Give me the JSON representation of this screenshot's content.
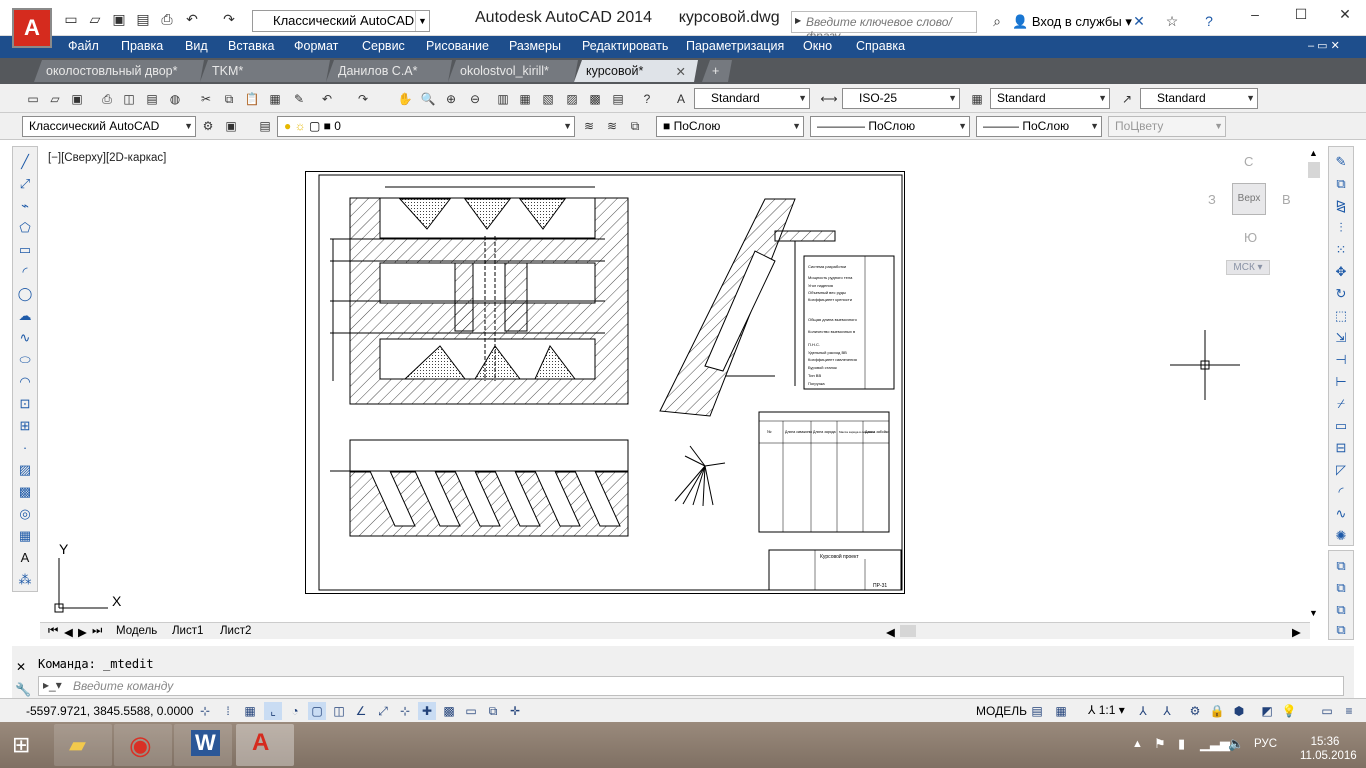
{
  "title_bar": {
    "app_name": "Autodesk AutoCAD 2014",
    "file_name": "курсовой.dwg",
    "workspace": "Классический AutoCAD",
    "search_placeholder": "Введите ключевое слово/фразу",
    "signin": "Вход в службы"
  },
  "menu": [
    "Файл",
    "Правка",
    "Вид",
    "Вставка",
    "Формат",
    "Сервис",
    "Рисование",
    "Размеры",
    "Редактировать",
    "Параметризация",
    "Окно",
    "Справка"
  ],
  "file_tabs": [
    {
      "label": "околостовльный двор*",
      "active": false
    },
    {
      "label": "TKM*",
      "active": false
    },
    {
      "label": "Данилов С.А*",
      "active": false
    },
    {
      "label": "okolostvol_kirill*",
      "active": false
    },
    {
      "label": "курсовой*",
      "active": true
    }
  ],
  "styles_toolbar": {
    "text_style": "Standard",
    "dim_style": "ISO-25",
    "table_style": "Standard",
    "mleader_style": "Standard"
  },
  "layers_toolbar": {
    "workspace": "Классический AutoCAD",
    "layer": "0",
    "color": "ПоСлою",
    "linetype": "ПоСлою",
    "lineweight": "ПоСлою",
    "plotstyle": "ПоЦвету"
  },
  "viewport": {
    "label": "[−][Сверху][2D-каркас]",
    "viewcube": {
      "n": "С",
      "s": "Ю",
      "w": "З",
      "e": "В",
      "top": "Верх"
    },
    "wcs": "МСК"
  },
  "layout_tabs": [
    "Модель",
    "Лист1",
    "Лист2"
  ],
  "command": {
    "history": "Команда:  _mtedit",
    "placeholder": "Введите команду"
  },
  "status": {
    "coords": "-5597.9721, 3845.5588, 0.0000",
    "model": "МОДЕЛЬ",
    "scale": "1:1"
  },
  "drawing": {
    "title_block": "Курсовой проект",
    "sheet_code": "ПР-31",
    "table1": [
      "Система разработки",
      "Мощность рудного тела",
      "Угол падения",
      "Объемный вес руды",
      "Коэффициент крепости",
      "Общая длина выемочного",
      "Количество выемочных в",
      "П.Н.С.",
      "Удельный расход ВВ",
      "Коэффициент извлечения",
      "Буровой станок",
      "Тип ВВ",
      "Погрузка"
    ],
    "table2_head": [
      "№",
      "Длина скважины",
      "Длина заряда",
      "Масса заряда в скважине",
      "Длина забойки"
    ]
  },
  "taskbar": {
    "lang": "РУС",
    "time": "15:36",
    "date": "11.05.2016"
  }
}
